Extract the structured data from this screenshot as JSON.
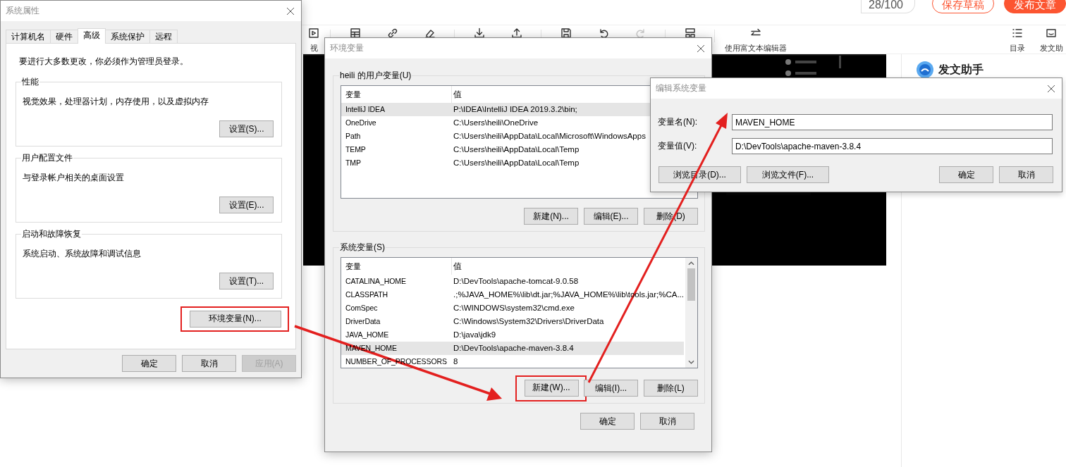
{
  "editor_page": {
    "word_count": "28/100",
    "header_buttons": [
      {
        "label": "保存草稿",
        "kind": "outline"
      },
      {
        "label": "发布文章",
        "kind": "primary"
      }
    ],
    "toolbar": {
      "groups": [
        [
          {
            "kind": "video",
            "label": "视",
            "disabled": false
          }
        ],
        [
          {
            "kind": "table",
            "disabled": false
          },
          {
            "kind": "link",
            "disabled": false
          },
          {
            "kind": "eraser",
            "disabled": false
          }
        ],
        [
          {
            "kind": "download",
            "disabled": false
          },
          {
            "kind": "upload",
            "disabled": false
          }
        ],
        [
          {
            "kind": "save",
            "disabled": false
          },
          {
            "kind": "undo",
            "disabled": false
          },
          {
            "kind": "redo",
            "disabled": true
          }
        ],
        [
          {
            "kind": "layout",
            "disabled": false
          }
        ],
        [
          {
            "kind": "switch",
            "label": "使用富文本编辑器",
            "disabled": false
          }
        ]
      ],
      "right_items": [
        {
          "kind": "outline",
          "label": "目录"
        },
        {
          "kind": "assistant",
          "label": "发文助"
        }
      ]
    },
    "assistant_panel": {
      "title": "发文助手"
    }
  },
  "system_properties": {
    "title": "系统属性",
    "tabs": [
      {
        "label": "计算机名",
        "selected": false
      },
      {
        "label": "硬件",
        "selected": false
      },
      {
        "label": "高级",
        "selected": true
      },
      {
        "label": "系统保护",
        "selected": false
      },
      {
        "label": "远程",
        "selected": false
      }
    ],
    "notice": "要进行大多数更改，你必须作为管理员登录。",
    "groups": [
      {
        "title": "性能",
        "description": "视觉效果，处理器计划，内存使用，以及虚拟内存",
        "button": {
          "label": "设置(S)...",
          "disabled": false,
          "highlighted": false
        }
      },
      {
        "title": "用户配置文件",
        "description": "与登录帐户相关的桌面设置",
        "button": {
          "label": "设置(E)...",
          "disabled": false,
          "highlighted": false
        }
      },
      {
        "title": "启动和故障恢复",
        "description": "系统启动、系统故障和调试信息",
        "button": {
          "label": "设置(T)...",
          "disabled": false,
          "highlighted": false
        }
      }
    ],
    "env_button": {
      "label": "环境变量(N)...",
      "disabled": false,
      "highlighted": true
    },
    "footer_buttons": [
      {
        "label": "确定",
        "disabled": false,
        "highlighted": false
      },
      {
        "label": "取消",
        "disabled": false,
        "highlighted": false
      },
      {
        "label": "应用(A)",
        "disabled": true,
        "highlighted": false
      }
    ]
  },
  "environment_variables": {
    "title": "环境变量",
    "sections": [
      {
        "title": "heili 的用户变量(U)",
        "columns": [
          "变量",
          "值"
        ],
        "rows": [
          {
            "name": "IntelliJ IDEA",
            "value": "P:\\IDEA\\IntelliJ IDEA 2019.3.2\\bin;",
            "selected": true
          },
          {
            "name": "OneDrive",
            "value": "C:\\Users\\heili\\OneDrive",
            "selected": false
          },
          {
            "name": "Path",
            "value": "C:\\Users\\heili\\AppData\\Local\\Microsoft\\WindowsApps",
            "selected": false
          },
          {
            "name": "TEMP",
            "value": "C:\\Users\\heili\\AppData\\Local\\Temp",
            "selected": false
          },
          {
            "name": "TMP",
            "value": "C:\\Users\\heili\\AppData\\Local\\Temp",
            "selected": false
          }
        ],
        "buttons": [
          {
            "label": "新建(N)...",
            "disabled": false,
            "highlighted": false
          },
          {
            "label": "编辑(E)...",
            "disabled": false,
            "highlighted": false
          },
          {
            "label": "删除(D)",
            "disabled": false,
            "highlighted": false
          }
        ]
      },
      {
        "title": "系统变量(S)",
        "columns": [
          "变量",
          "值"
        ],
        "scrollable": true,
        "rows": [
          {
            "name": "CATALINA_HOME",
            "value": "D:\\DevTools\\apache-tomcat-9.0.58",
            "selected": false
          },
          {
            "name": "CLASSPATH",
            "value": ".;%JAVA_HOME%\\lib\\dt.jar;%JAVA_HOME%\\lib\\tools.jar;%CA...",
            "selected": false
          },
          {
            "name": "ComSpec",
            "value": "C:\\WINDOWS\\system32\\cmd.exe",
            "selected": false
          },
          {
            "name": "DriverData",
            "value": "C:\\Windows\\System32\\Drivers\\DriverData",
            "selected": false
          },
          {
            "name": "JAVA_HOME",
            "value": "D:\\java\\jdk9",
            "selected": false
          },
          {
            "name": "MAVEN_HOME",
            "value": "D:\\DevTools\\apache-maven-3.8.4",
            "selected": true
          },
          {
            "name": "NUMBER_OF_PROCESSORS",
            "value": "8",
            "selected": false
          }
        ],
        "buttons": [
          {
            "label": "新建(W)...",
            "disabled": false,
            "highlighted": true
          },
          {
            "label": "编辑(I)...",
            "disabled": false,
            "highlighted": false
          },
          {
            "label": "删除(L)",
            "disabled": false,
            "highlighted": false
          }
        ]
      }
    ],
    "footer_buttons": [
      {
        "label": "确定",
        "disabled": false,
        "highlighted": false
      },
      {
        "label": "取消",
        "disabled": false,
        "highlighted": false
      }
    ]
  },
  "edit_variable": {
    "title": "编辑系统变量",
    "fields": [
      {
        "label": "变量名(N):",
        "value": "MAVEN_HOME"
      },
      {
        "label": "变量值(V):",
        "value": "D:\\DevTools\\apache-maven-3.8.4"
      }
    ],
    "browse_buttons": [
      {
        "label": "浏览目录(D)...",
        "disabled": false,
        "highlighted": false
      },
      {
        "label": "浏览文件(F)...",
        "disabled": false,
        "highlighted": false
      }
    ],
    "buttons": [
      {
        "label": "确定",
        "disabled": false,
        "highlighted": false
      },
      {
        "label": "取消",
        "disabled": false,
        "highlighted": false
      }
    ]
  }
}
